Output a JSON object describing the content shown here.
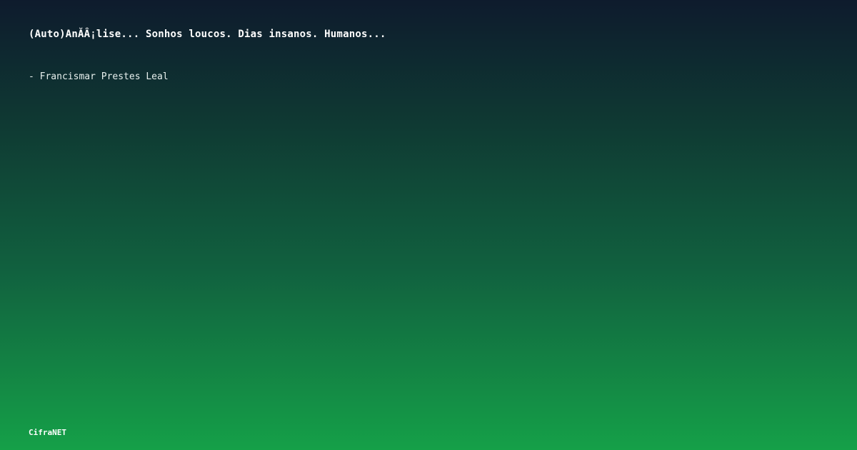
{
  "card": {
    "quote": "(Auto)AnĂÂ¡lise... Sonhos loucos. Dias insanos. Humanos...",
    "author": "- Francismar Prestes Leal",
    "brand": "CifraNET"
  },
  "colors": {
    "gradient_top": "#0e1b2d",
    "gradient_bottom": "#15a048",
    "text": "#ffffff"
  }
}
